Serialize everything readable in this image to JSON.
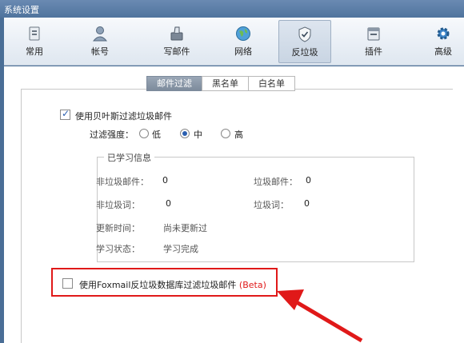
{
  "window": {
    "title": "系统设置"
  },
  "toolbar": {
    "items": [
      {
        "label": "常用",
        "icon": "general-icon"
      },
      {
        "label": "帐号",
        "icon": "account-icon"
      },
      {
        "label": "写邮件",
        "icon": "compose-icon"
      },
      {
        "label": "网络",
        "icon": "network-icon"
      },
      {
        "label": "反垃圾",
        "icon": "antispam-icon",
        "active": true
      },
      {
        "label": "插件",
        "icon": "plugin-icon"
      },
      {
        "label": "高级",
        "icon": "advanced-icon"
      }
    ]
  },
  "tabs": [
    {
      "label": "邮件过滤",
      "active": true
    },
    {
      "label": "黑名单"
    },
    {
      "label": "白名单"
    }
  ],
  "bayes": {
    "label": "使用贝叶斯过滤垃圾邮件",
    "checked": true,
    "strength_label": "过滤强度：",
    "options": [
      "低",
      "中",
      "高"
    ],
    "selected": "中"
  },
  "learned": {
    "title": "已学习信息",
    "non_spam_mail_label": "非垃圾邮件：",
    "non_spam_mail_value": "0",
    "spam_mail_label": "垃圾邮件：",
    "spam_mail_value": "0",
    "non_spam_word_label": "非垃圾词：",
    "non_spam_word_value": "0",
    "spam_word_label": "垃圾词：",
    "spam_word_value": "0",
    "update_time_label": "更新时间：",
    "update_time_value": "尚未更新过",
    "status_label": "学习状态：",
    "status_value": "学习完成"
  },
  "foxmail_db": {
    "label": "使用Foxmail反垃圾数据库过滤垃圾邮件",
    "beta": "(Beta)",
    "checked": false
  },
  "colors": {
    "highlight": "#e01919",
    "titlebar": "#4f739d",
    "accent": "#2a5fb0"
  }
}
